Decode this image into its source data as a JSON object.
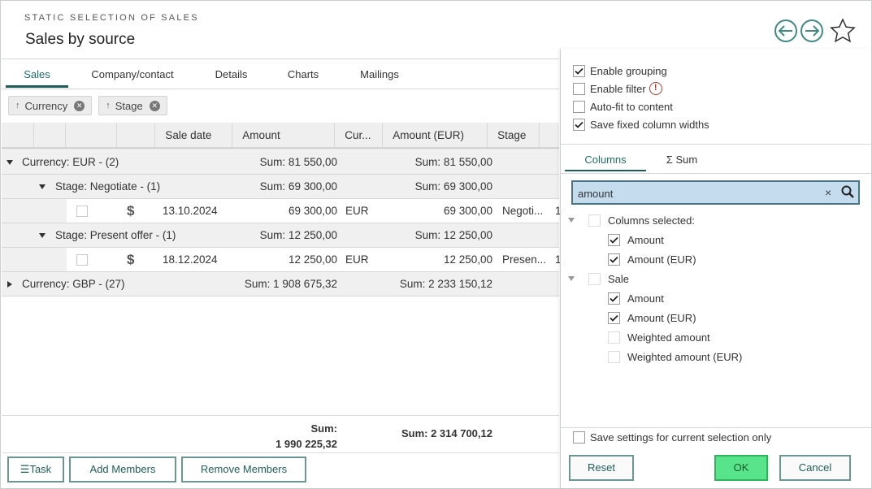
{
  "header": {
    "subtitle": "STATIC SELECTION OF SALES",
    "title": "Sales by source",
    "icons": [
      "arrow-left-circle",
      "arrow-right-circle",
      "star"
    ]
  },
  "tabs": [
    {
      "label": "Sales",
      "active": true
    },
    {
      "label": "Company/contact",
      "active": false
    },
    {
      "label": "Details",
      "active": false
    },
    {
      "label": "Charts",
      "active": false
    },
    {
      "label": "Mailings",
      "active": false
    }
  ],
  "group_chips": [
    {
      "label": "Currency",
      "icon": "arrow-up"
    },
    {
      "label": "Stage",
      "icon": "arrow-up"
    }
  ],
  "grid": {
    "columns": [
      "",
      "",
      "",
      "",
      "Sale date",
      "Amount",
      "Cur...",
      "Amount (EUR)",
      "Stage"
    ],
    "rows": [
      {
        "type": "group",
        "level": 0,
        "expanded": true,
        "label": "Currency: EUR - (2)",
        "sum_amount": "Sum: 81 550,00",
        "sum_amount_eur": "Sum: 81 550,00"
      },
      {
        "type": "group",
        "level": 1,
        "expanded": true,
        "label": "Stage: Negotiate - (1)",
        "sum_amount": "Sum: 69 300,00",
        "sum_amount_eur": "Sum: 69 300,00"
      },
      {
        "type": "data",
        "icon": "dollar",
        "date": "13.10.2024",
        "amount": "69 300,00",
        "currency": "EUR",
        "amount_eur": "69 300,00",
        "stage": "Negoti...",
        "extra": "1"
      },
      {
        "type": "group",
        "level": 1,
        "expanded": true,
        "label": "Stage: Present offer - (1)",
        "sum_amount": "Sum: 12 250,00",
        "sum_amount_eur": "Sum: 12 250,00"
      },
      {
        "type": "data",
        "icon": "dollar",
        "date": "18.12.2024",
        "amount": "12 250,00",
        "currency": "EUR",
        "amount_eur": "12 250,00",
        "stage": "Presen...",
        "extra": "1"
      },
      {
        "type": "group",
        "level": 0,
        "expanded": false,
        "label": "Currency: GBP - (27)",
        "sum_amount": "Sum: 1 908 675,32",
        "sum_amount_eur": "Sum: 2 233 150,12"
      }
    ],
    "totals": {
      "amount_label": "Sum:",
      "amount_value": "1 990 225,32",
      "amount_eur": "Sum: 2 314 700,12"
    }
  },
  "bottom_buttons": {
    "task": "Task",
    "add_members": "Add Members",
    "remove_members": "Remove Members"
  },
  "panel": {
    "options": [
      {
        "label": "Enable grouping",
        "checked": true
      },
      {
        "label": "Enable filter",
        "checked": false,
        "warning": true
      },
      {
        "label": "Auto-fit to content",
        "checked": false
      },
      {
        "label": "Save fixed column widths",
        "checked": true
      }
    ],
    "tabs": [
      {
        "label": "Columns",
        "active": true
      },
      {
        "label": "Σ Sum",
        "active": false
      }
    ],
    "search": {
      "value": "amount",
      "placeholder": ""
    },
    "tree": [
      {
        "label": "Columns selected:",
        "level": 0,
        "checked": false,
        "expanded": true
      },
      {
        "label": "Amount",
        "level": 1,
        "checked": true
      },
      {
        "label": "Amount (EUR)",
        "level": 1,
        "checked": true
      },
      {
        "label": "Sale",
        "level": 0,
        "checked": false,
        "expanded": true
      },
      {
        "label": "Amount",
        "level": 1,
        "checked": true
      },
      {
        "label": "Amount (EUR)",
        "level": 1,
        "checked": true
      },
      {
        "label": "Weighted amount",
        "level": 1,
        "checked": false
      },
      {
        "label": "Weighted amount (EUR)",
        "level": 1,
        "checked": false
      }
    ],
    "save_for_selection": {
      "label": "Save settings for current selection only",
      "checked": false
    },
    "buttons": {
      "reset": "Reset",
      "ok": "OK",
      "cancel": "Cancel"
    }
  },
  "colors": {
    "accent": "#1e5e59",
    "ok_button": "#58e48a",
    "search_bg": "#c4dcee",
    "warning": "#b03a2e"
  }
}
